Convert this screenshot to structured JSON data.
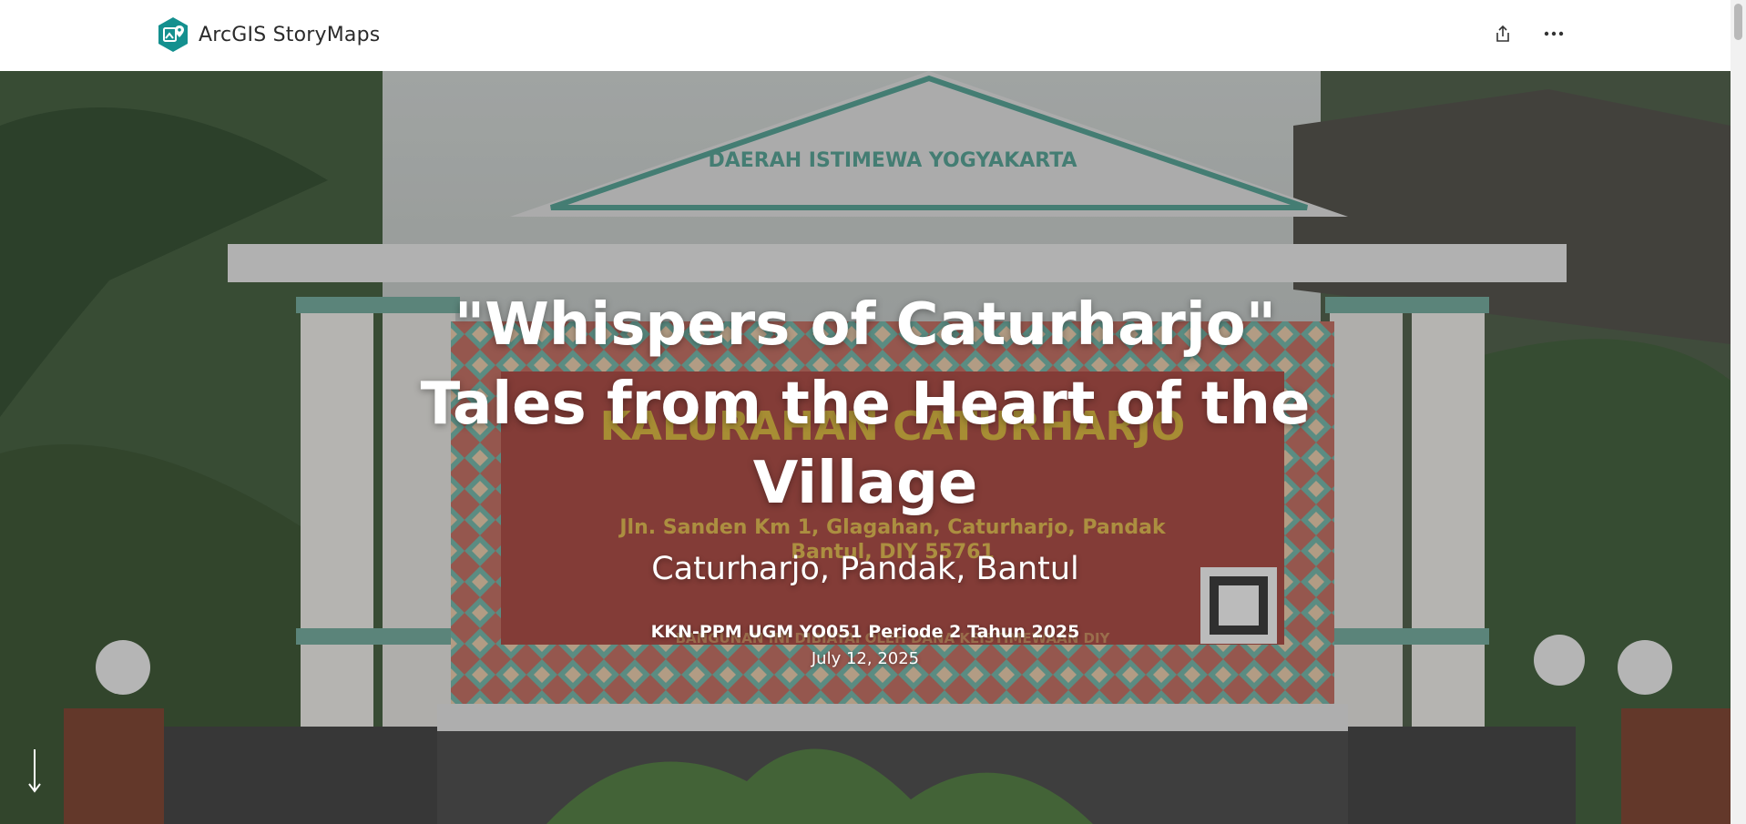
{
  "header": {
    "brand_name": "ArcGIS StoryMaps",
    "brand_icon": "storymaps-logo-icon",
    "share_icon": "share-icon",
    "more_icon": "more-options-icon"
  },
  "hero": {
    "title": "\"Whispers of Caturharjo\" Tales from the Heart of the Village",
    "subtitle": "Caturharjo, Pandak, Bantul",
    "byline": "KKN-PPM UGM YO051 Periode 2 Tahun 2025",
    "date": "July 12, 2025",
    "background_image": {
      "gate_top_text": "DAERAH ISTIMEWA YOGYAKARTA",
      "sign_title": "KALURAHAN CATURHARJO",
      "sign_address_1": "Jln. Sanden Km 1, Glagahan, Caturharjo, Pandak",
      "sign_address_2": "Bantul, DIY 55761",
      "sign_footer": "BANGUNAN INI DIBIAYAI OLEH DANA KEISTIMEWAAN DIY"
    },
    "scroll_icon": "scroll-down-icon"
  },
  "colors": {
    "brand_teal": "#14908f",
    "header_bg": "#ffffff",
    "hero_text": "#ffffff"
  }
}
